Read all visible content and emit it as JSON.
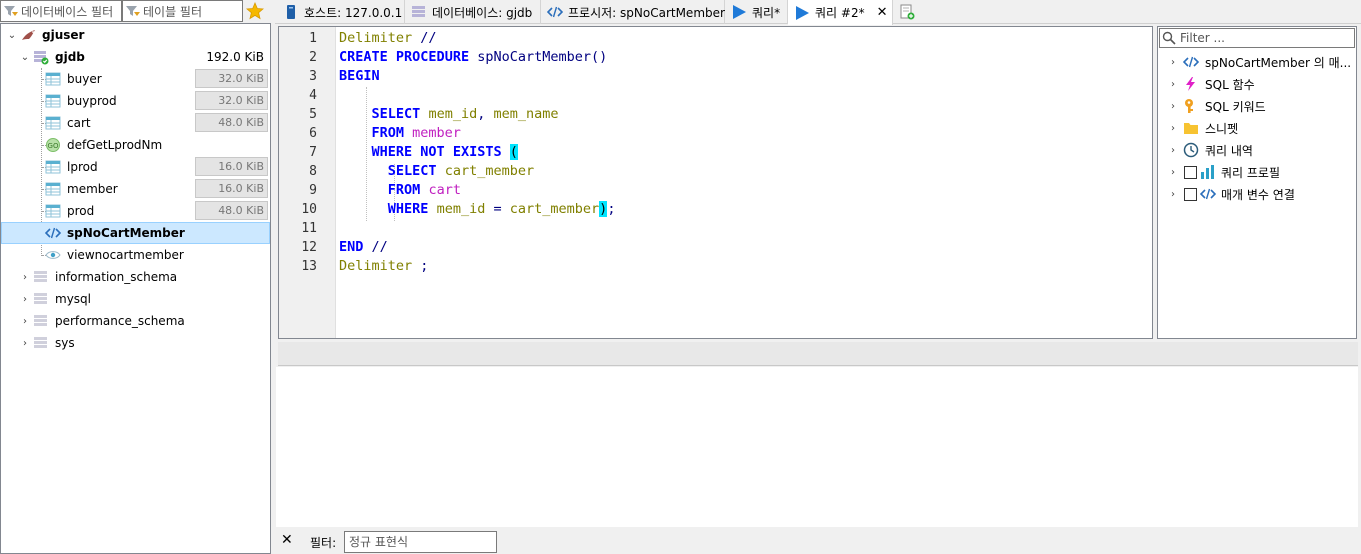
{
  "filters": {
    "database_placeholder": "데이터베이스 필터",
    "table_placeholder": "테이블 필터"
  },
  "tree": {
    "session": "gjuser",
    "database": {
      "name": "gjdb",
      "size": "192.0 KiB"
    },
    "items": [
      {
        "name": "buyer",
        "type": "table",
        "size": "32.0 KiB",
        "fill": 0.67
      },
      {
        "name": "buyprod",
        "type": "table",
        "size": "32.0 KiB",
        "fill": 0.67
      },
      {
        "name": "cart",
        "type": "table",
        "size": "48.0 KiB",
        "fill": 1.0
      },
      {
        "name": "defGetLprodNm",
        "type": "function",
        "size": ""
      },
      {
        "name": "lprod",
        "type": "table",
        "size": "16.0 KiB",
        "fill": 0.33
      },
      {
        "name": "member",
        "type": "table",
        "size": "16.0 KiB",
        "fill": 0.33
      },
      {
        "name": "prod",
        "type": "table",
        "size": "48.0 KiB",
        "fill": 1.0
      },
      {
        "name": "spNoCartMember",
        "type": "procedure",
        "size": "",
        "selected": true
      },
      {
        "name": "viewnocartmember",
        "type": "view",
        "size": ""
      }
    ],
    "other_databases": [
      "information_schema",
      "mysql",
      "performance_schema",
      "sys"
    ]
  },
  "tabs": [
    {
      "label": "호스트: 127.0.0.1",
      "icon": "server-icon"
    },
    {
      "label": "데이터베이스: gjdb",
      "icon": "database-icon"
    },
    {
      "label": "프로시저: spNoCartMember",
      "icon": "procedure-icon"
    },
    {
      "label": "쿼리*",
      "icon": "play-icon"
    },
    {
      "label": "쿼리 #2*",
      "icon": "play-icon",
      "active": true
    }
  ],
  "editor": {
    "line_numbers": [
      "1",
      "2",
      "3",
      "4",
      "5",
      "6",
      "7",
      "8",
      "9",
      "10",
      "11",
      "12",
      "13"
    ],
    "lines": [
      "Delimiter //",
      "CREATE PROCEDURE spNoCartMember()",
      "BEGIN",
      "",
      "    SELECT mem_id, mem_name",
      "    FROM member",
      "    WHERE NOT EXISTS (",
      "      SELECT cart_member",
      "      FROM cart",
      "      WHERE mem_id = cart_member);",
      "",
      "END //",
      "Delimiter ;"
    ]
  },
  "helper": {
    "filter_placeholder": "Filter ...",
    "items": [
      {
        "label": "spNoCartMember 의 매...",
        "icon": "procedure-icon"
      },
      {
        "label": "SQL 함수",
        "icon": "lightning-icon"
      },
      {
        "label": "SQL 키워드",
        "icon": "key-icon"
      },
      {
        "label": "스니펫",
        "icon": "folder-icon"
      },
      {
        "label": "쿼리 내역",
        "icon": "clock-icon"
      },
      {
        "label": "쿼리 프로필",
        "icon": "bar-chart-icon",
        "checkbox": true
      },
      {
        "label": "매개 변수 연결",
        "icon": "procedure-icon",
        "checkbox": true
      }
    ]
  },
  "bottom_filter": {
    "label": "필터:",
    "placeholder": "정규 표현식"
  },
  "colors": {
    "keyword": "#0000ff",
    "identifier": "#808000",
    "table": "#c020c0",
    "selection": "#cce8ff",
    "bracket_match": "#00e5ff"
  }
}
